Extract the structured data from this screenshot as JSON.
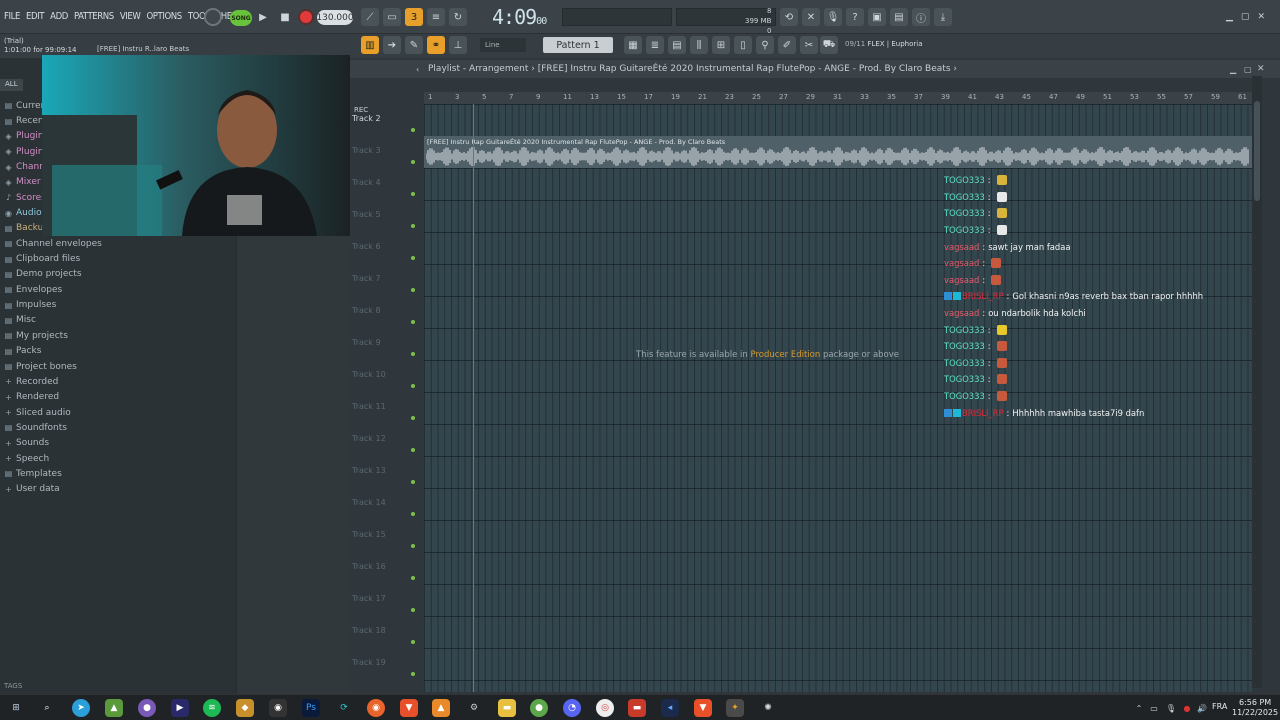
{
  "app": {
    "menus": [
      "FILE",
      "EDIT",
      "ADD",
      "PATTERNS",
      "VIEW",
      "OPTIONS",
      "TOOLS",
      "HELP"
    ],
    "mode_label": "SONG",
    "tempo": "130.000",
    "time_main": "4:09",
    "time_sub": "00",
    "memory": "399 MB",
    "memory_sub": "8",
    "cpu_sub": "0",
    "trial_label": "(Trial)",
    "trial_position": "1:01:00 for 99:09:14",
    "hint_text": "[FREE] Instru R..laro Beats",
    "snap_label": "Line",
    "pattern_label": "Pattern 1",
    "flex_counter": "09/11",
    "flex_label": "FLEX | Euphoria"
  },
  "browser": {
    "tabs": [
      "ALL"
    ],
    "items": [
      {
        "label": "Curren",
        "icon": "folder-icon",
        "style": "normal"
      },
      {
        "label": "Recent",
        "icon": "folder-icon",
        "style": "normal"
      },
      {
        "label": "Plugin",
        "icon": "plug-icon",
        "style": "pink"
      },
      {
        "label": "Plugin",
        "icon": "plug-icon",
        "style": "pink"
      },
      {
        "label": "Chann",
        "icon": "plug-icon",
        "style": "pink"
      },
      {
        "label": "Mixer",
        "icon": "plug-icon",
        "style": "pink"
      },
      {
        "label": "Scores",
        "icon": "music-icon",
        "style": "pink"
      },
      {
        "label": "Audio",
        "icon": "audio-icon",
        "style": "blue"
      },
      {
        "label": "Backup",
        "icon": "folder-icon",
        "style": "gold"
      },
      {
        "label": "Channel envelopes",
        "icon": "folder-icon",
        "style": "normal"
      },
      {
        "label": "Clipboard files",
        "icon": "folder-icon",
        "style": "normal"
      },
      {
        "label": "Demo projects",
        "icon": "folder-icon",
        "style": "normal"
      },
      {
        "label": "Envelopes",
        "icon": "folder-icon",
        "style": "normal"
      },
      {
        "label": "Impulses",
        "icon": "folder-icon",
        "style": "normal"
      },
      {
        "label": "Misc",
        "icon": "folder-icon",
        "style": "normal"
      },
      {
        "label": "My projects",
        "icon": "folder-icon",
        "style": "normal"
      },
      {
        "label": "Packs",
        "icon": "folder-icon",
        "style": "normal"
      },
      {
        "label": "Project bones",
        "icon": "folder-icon",
        "style": "normal"
      },
      {
        "label": "Recorded",
        "icon": "plus-icon",
        "style": "normal"
      },
      {
        "label": "Rendered",
        "icon": "plus-icon",
        "style": "normal"
      },
      {
        "label": "Sliced audio",
        "icon": "plus-icon",
        "style": "normal"
      },
      {
        "label": "Soundfonts",
        "icon": "folder-icon",
        "style": "normal"
      },
      {
        "label": "Sounds",
        "icon": "plus-icon",
        "style": "normal"
      },
      {
        "label": "Speech",
        "icon": "plus-icon",
        "style": "normal"
      },
      {
        "label": "Templates",
        "icon": "folder-icon",
        "style": "normal"
      },
      {
        "label": "User data",
        "icon": "plus-icon",
        "style": "normal"
      }
    ],
    "tags_label": "TAGS"
  },
  "playlist": {
    "title_prefix": "Playlist - Arrangement",
    "title_clip": "[FREE] Instru Rap GuitareÉté 2020  Instrumental Rap FlutePop - ANGE - Prod. By Claro Beats",
    "rec_label": "REC",
    "ruler": [
      "1",
      "3",
      "5",
      "7",
      "9",
      "11",
      "13",
      "15",
      "17",
      "19",
      "21",
      "23",
      "25",
      "27",
      "29",
      "31",
      "33",
      "35",
      "37",
      "39",
      "41",
      "43",
      "45",
      "47",
      "49",
      "51",
      "53",
      "55",
      "57",
      "59",
      "61"
    ],
    "tracks": [
      "Track 2",
      "Track 3",
      "Track 4",
      "Track 5",
      "Track 6",
      "Track 7",
      "Track 8",
      "Track 9",
      "Track 10",
      "Track 11",
      "Track 12",
      "Track 13",
      "Track 14",
      "Track 15",
      "Track 16",
      "Track 17",
      "Track 18",
      "Track 19"
    ],
    "clip_text": "[FREE] Instru Rap GuitareÉté 2020  Instrumental Rap FlutePop - ANGE - Prod. By Claro Beats",
    "notice_pre": "This feature is available in ",
    "notice_link": "Producer Edition",
    "notice_post": " package or above"
  },
  "chat": [
    {
      "user": "TOGO333",
      "sep": ":",
      "text": "",
      "user_color": "#5ee0c8",
      "emoji": "#d8b53a"
    },
    {
      "user": "TOGO333",
      "sep": ":",
      "text": "",
      "user_color": "#5ee0c8",
      "emoji": "#e8e8e8"
    },
    {
      "user": "TOGO333",
      "sep": ":",
      "text": "",
      "user_color": "#5ee0c8",
      "emoji": "#d8b53a"
    },
    {
      "user": "TOGO333",
      "sep": ":",
      "text": "",
      "user_color": "#5ee0c8",
      "emoji": "#e8e8e8"
    },
    {
      "user": "vagsaad",
      "sep": ":",
      "text": "sawt jay man fadaa",
      "user_color": "#e85a6a",
      "emoji": ""
    },
    {
      "user": "vagsaad",
      "sep": ":",
      "text": "",
      "user_color": "#e85a6a",
      "emoji": "#c75a3c"
    },
    {
      "user": "vagsaad",
      "sep": ":",
      "text": "",
      "user_color": "#e85a6a",
      "emoji": "#c75a3c"
    },
    {
      "user": "BRISLI_RP",
      "sep": ":",
      "text": "Gol khasni n9as reverb bax tban rapor hhhhh",
      "user_color": "#e02a3a",
      "emoji": "",
      "badges": true
    },
    {
      "user": "vagsaad",
      "sep": ":",
      "text": "ou ndarbolik hda kolchi",
      "user_color": "#e85a6a",
      "emoji": ""
    },
    {
      "user": "TOGO333",
      "sep": ":",
      "text": "",
      "user_color": "#5ee0c8",
      "emoji": "#e8c92a"
    },
    {
      "user": "TOGO333",
      "sep": ":",
      "text": "",
      "user_color": "#5ee0c8",
      "emoji": "#c75a3c"
    },
    {
      "user": "TOGO333",
      "sep": ":",
      "text": "",
      "user_color": "#5ee0c8",
      "emoji": "#c75a3c"
    },
    {
      "user": "TOGO333",
      "sep": ":",
      "text": "",
      "user_color": "#5ee0c8",
      "emoji": "#c75a3c"
    },
    {
      "user": "TOGO333",
      "sep": ":",
      "text": "",
      "user_color": "#5ee0c8",
      "emoji": "#c75a3c"
    },
    {
      "user": "BRISLI_RP",
      "sep": ":",
      "text": "Hhhhhh mawhiba tasta7i9 dafn",
      "user_color": "#e02a3a",
      "emoji": "",
      "badges": true
    }
  ],
  "taskbar": {
    "language": "FRA",
    "time": "6:56 PM",
    "date": "11/22/2025"
  },
  "colors": {
    "accent_orange": "#e8a02a",
    "rec_red": "#e03a3a",
    "song_green": "#68c23a",
    "track_dot_green": "#7cc24a"
  }
}
